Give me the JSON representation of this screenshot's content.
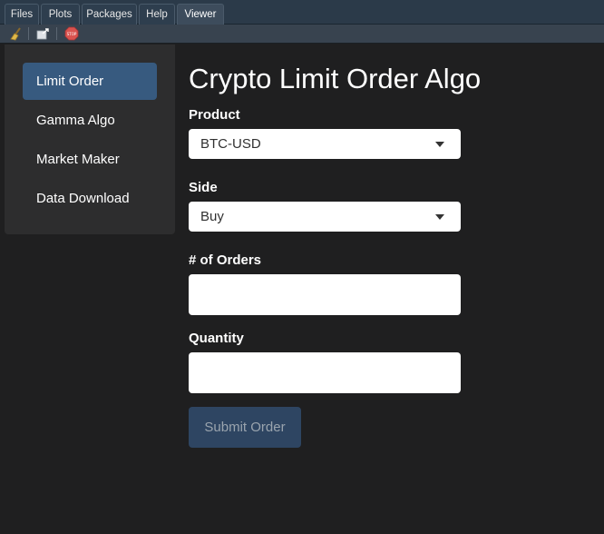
{
  "pane_tabs": [
    {
      "label": "Files",
      "active": false
    },
    {
      "label": "Plots",
      "active": false
    },
    {
      "label": "Packages",
      "active": false
    },
    {
      "label": "Help",
      "active": false
    },
    {
      "label": "Viewer",
      "active": true
    }
  ],
  "toolbar": {
    "buttons": [
      {
        "icon": "broom-icon",
        "action": "clear"
      },
      {
        "icon": "export-icon",
        "action": "export"
      },
      {
        "icon": "stop-icon",
        "action": "stop",
        "text": "STOP"
      }
    ]
  },
  "sidebar": {
    "items": [
      {
        "label": "Limit Order",
        "active": true
      },
      {
        "label": "Gamma Algo",
        "active": false
      },
      {
        "label": "Market Maker",
        "active": false
      },
      {
        "label": "Data Download",
        "active": false
      }
    ]
  },
  "main": {
    "title": "Crypto Limit Order Algo",
    "product": {
      "label": "Product",
      "value": "BTC-USD"
    },
    "side": {
      "label": "Side",
      "value": "Buy"
    },
    "num_orders": {
      "label": "# of Orders",
      "value": ""
    },
    "quantity": {
      "label": "Quantity",
      "value": ""
    },
    "submit_label": "Submit Order"
  },
  "colors": {
    "background": "#1f1f20",
    "sidebar": "#2d2d2e",
    "active_nav": "#375a7f",
    "submit_button": "#2e4562"
  }
}
